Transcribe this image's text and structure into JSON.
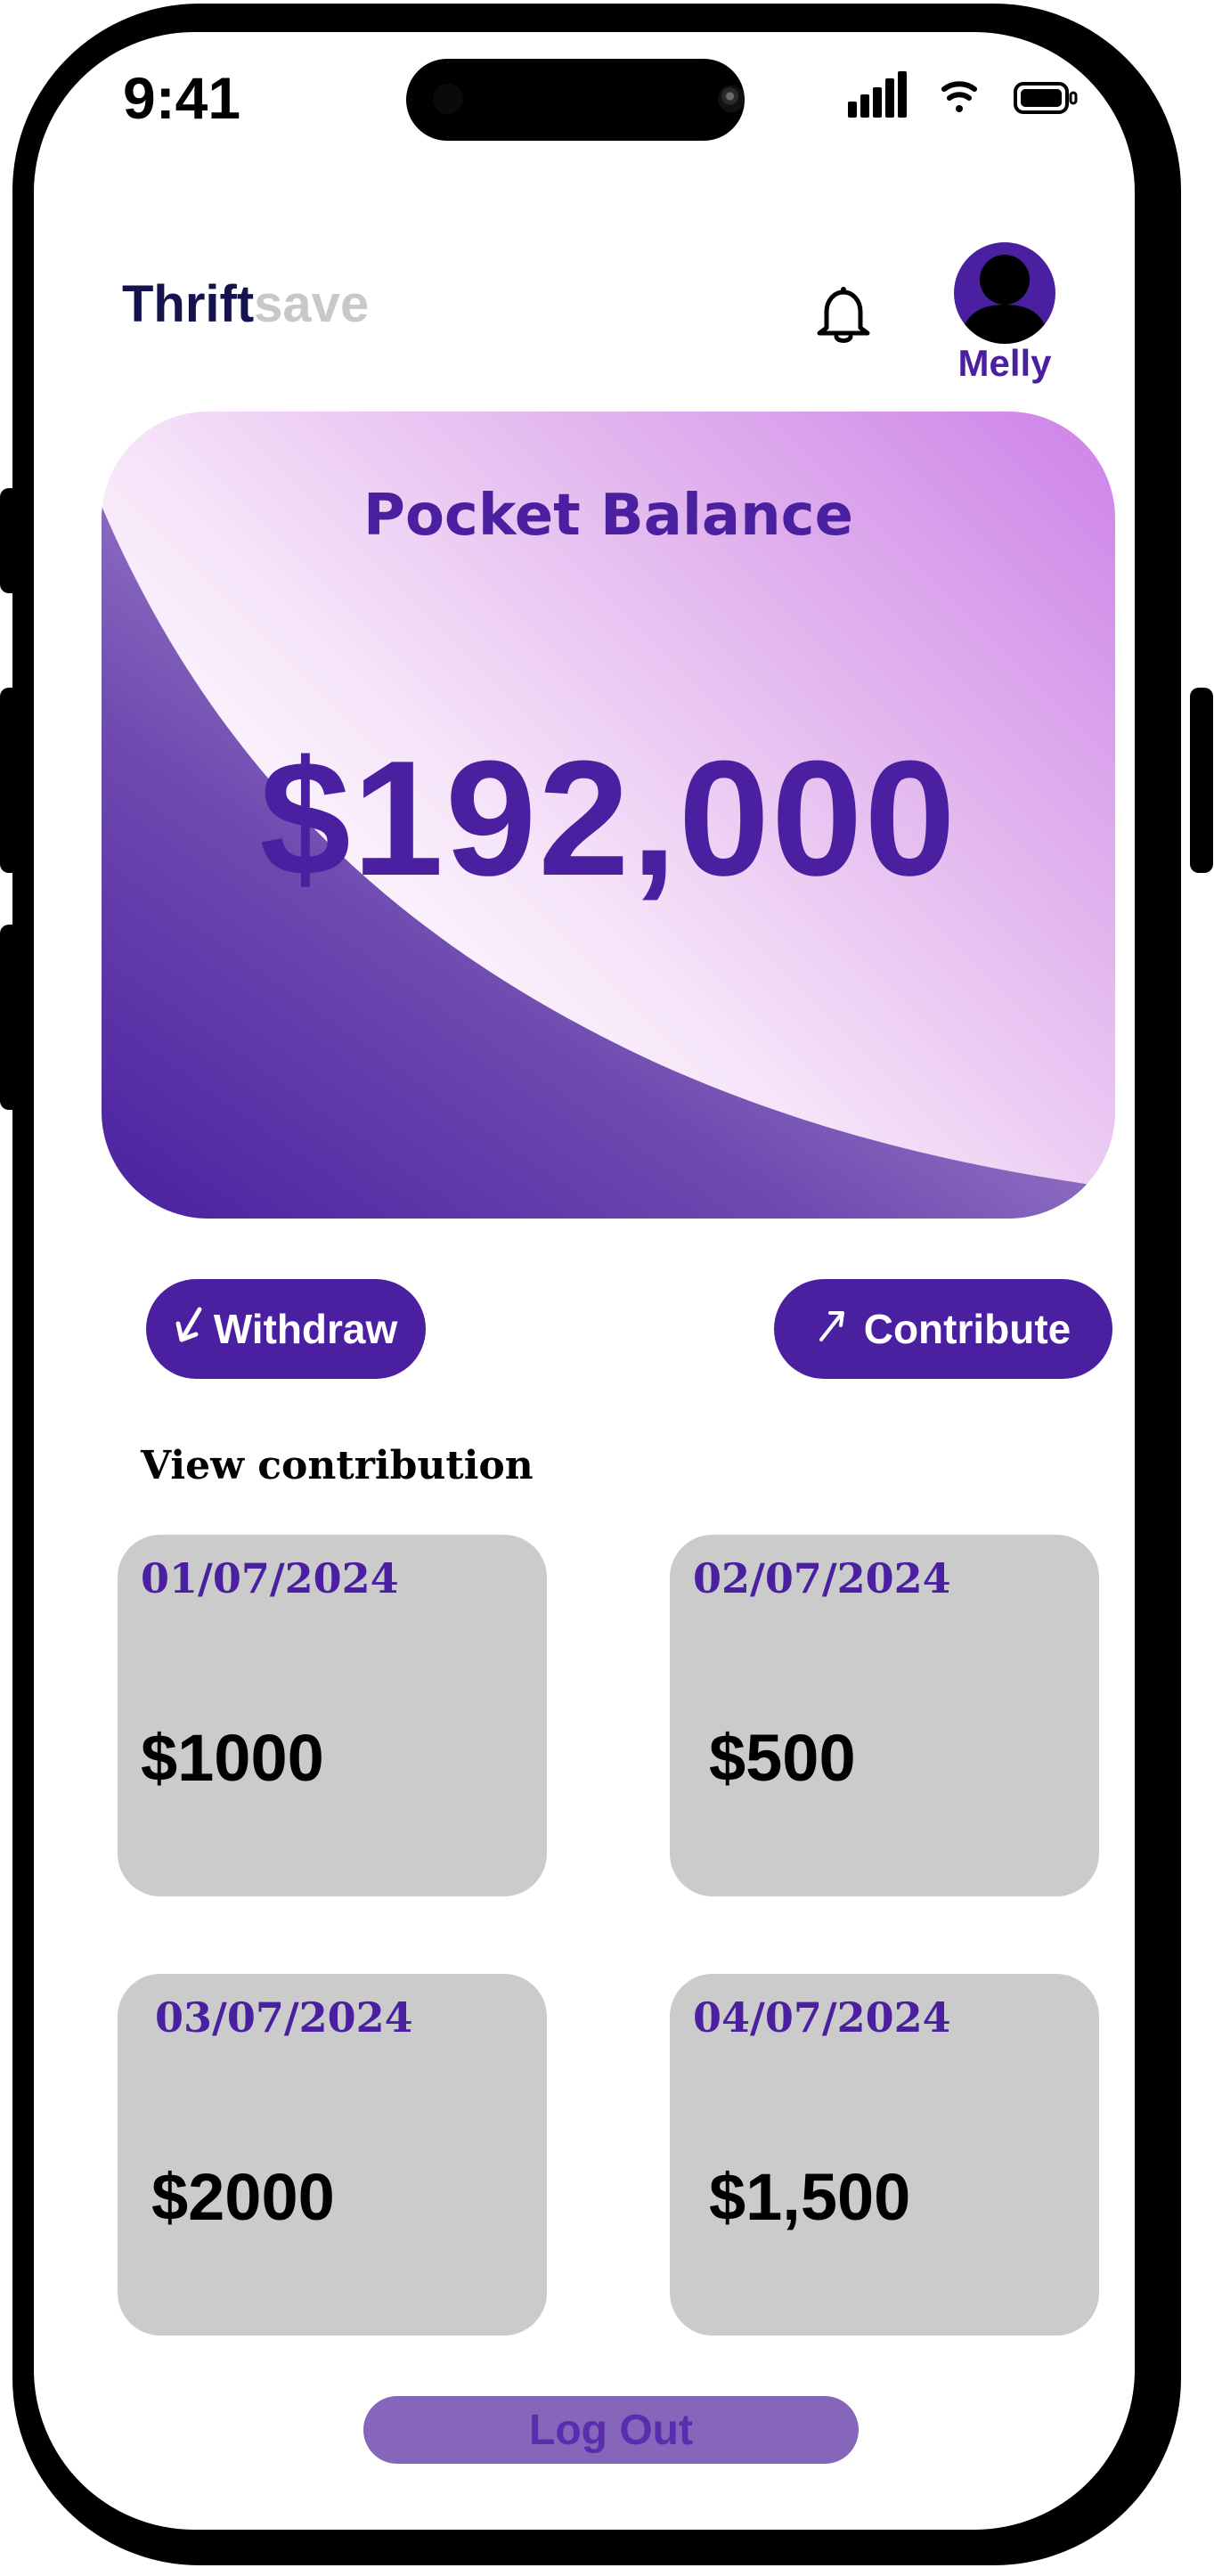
{
  "status_bar": {
    "time": "9:41",
    "icons": [
      "signal-icon",
      "wifi-icon",
      "battery-icon"
    ]
  },
  "header": {
    "brand_part1": "Thrift",
    "brand_part2": "save",
    "notification_icon": "bell-icon",
    "user_name": "Melly"
  },
  "balance_card": {
    "title": "Pocket Balance",
    "amount": "$192,000"
  },
  "actions": {
    "withdraw_label": "Withdraw",
    "contribute_label": "Contribute"
  },
  "contributions": {
    "title": "View contribution",
    "items": [
      {
        "date": "01/07/2024",
        "amount": "$1000"
      },
      {
        "date": "02/07/2024",
        "amount": "$500"
      },
      {
        "date": "03/07/2024",
        "amount": "$2000"
      },
      {
        "date": "04/07/2024",
        "amount": "$1,500"
      }
    ]
  },
  "footer": {
    "logout_label": "Log Out"
  },
  "colors": {
    "brand_primary": "#4a20a0",
    "brand_dark": "#14134d",
    "brand_muted": "#c8c8c8",
    "tile_background": "#cbcbcb",
    "logout_background": "#8566ba"
  }
}
